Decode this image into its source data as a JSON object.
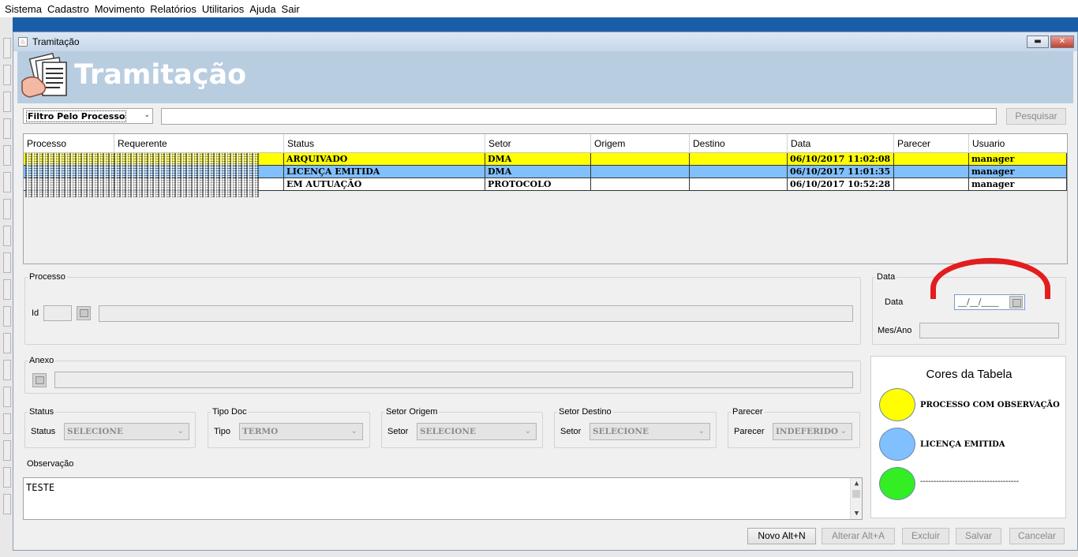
{
  "menu": {
    "items": [
      "Sistema",
      "Cadastro",
      "Movimento",
      "Relatórios",
      "Utilitarios",
      "Ajuda",
      "Sair"
    ]
  },
  "window": {
    "title": "Tramitação",
    "minimize_icon": "minimize-icon",
    "close_icon": "close-icon"
  },
  "header": {
    "title": "Tramitação",
    "icon": "documents-hand-icon"
  },
  "filter": {
    "selected": "Filtro Pelo Processo",
    "search_value": "",
    "search_button": "Pesquisar"
  },
  "table": {
    "columns": [
      "Processo",
      "Requerente",
      "Status",
      "Setor",
      "Origem",
      "Destino",
      "Data",
      "Parecer",
      "Usuario"
    ],
    "rows": [
      {
        "status": "ARQUIVADO",
        "setor": "DMA",
        "origem": "",
        "destino": "",
        "data": "06/10/2017 11:02:08",
        "parecer": "",
        "usuario": "manager",
        "color": "#ffff00"
      },
      {
        "status": "LICENÇA EMITIDA",
        "setor": "DMA",
        "origem": "",
        "destino": "",
        "data": "06/10/2017 11:01:35",
        "parecer": "",
        "usuario": "manager",
        "color": "#80c0ff"
      },
      {
        "status": "EM AUTUAÇÃO",
        "setor": "PROTOCOLO",
        "origem": "",
        "destino": "",
        "data": "06/10/2017 10:52:28",
        "parecer": "",
        "usuario": "manager",
        "color": "#ffffff"
      }
    ]
  },
  "processo": {
    "legend": "Processo",
    "id_label": "Id",
    "id_value": "",
    "desc_value": ""
  },
  "data_panel": {
    "legend": "Data",
    "data_label": "Data",
    "data_value": "__/__/____",
    "mesano_label": "Mes/Ano",
    "mesano_value": ""
  },
  "anexo": {
    "legend": "Anexo",
    "value": ""
  },
  "status": {
    "legend": "Status",
    "label": "Status",
    "value": "SELECIONE"
  },
  "tipo_doc": {
    "legend": "Tipo Doc",
    "label": "Tipo",
    "value": "TERMO"
  },
  "setor_origem": {
    "legend": "Setor Origem",
    "label": "Setor",
    "value": "SELECIONE"
  },
  "setor_destino": {
    "legend": "Setor Destino",
    "label": "Setor",
    "value": "SELECIONE"
  },
  "parecer": {
    "legend": "Parecer",
    "label": "Parecer",
    "value": "INDEFERIDO"
  },
  "observacao": {
    "label": "Observação",
    "value": "TESTE"
  },
  "cores": {
    "title": "Cores da Tabela",
    "items": [
      {
        "color": "#ffff00",
        "label": "PROCESSO COM OBSERVAÇÃO"
      },
      {
        "color": "#80c0ff",
        "label": "LICENÇA EMITIDA"
      },
      {
        "color": "#33ee22",
        "label": "-------------------------------------"
      }
    ]
  },
  "actions": {
    "novo": "Novo Alt+N",
    "alterar": "Alterar Alt+A",
    "excluir": "Excluir",
    "salvar": "Salvar",
    "cancelar": "Cancelar"
  }
}
